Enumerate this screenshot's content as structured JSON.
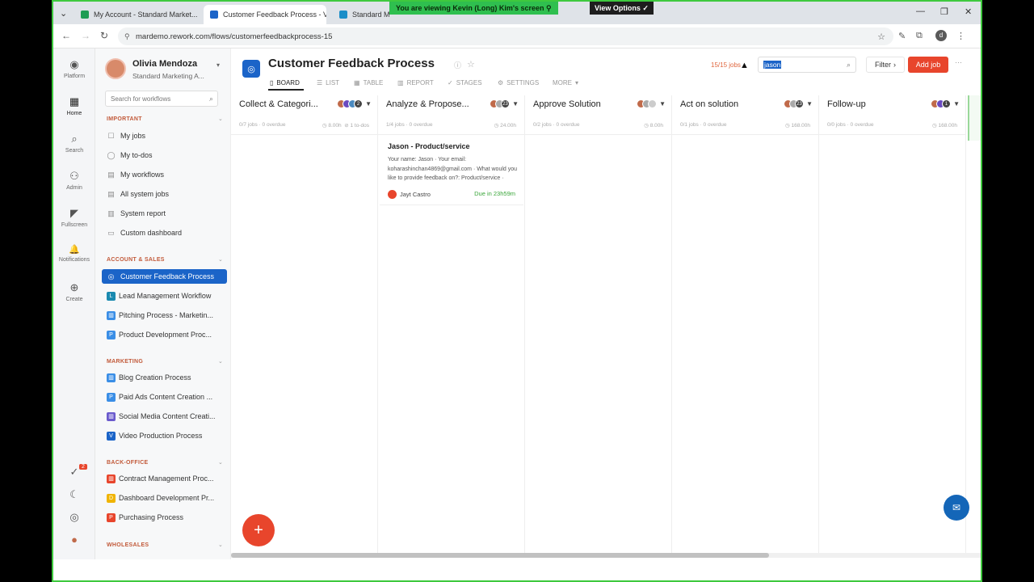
{
  "browser": {
    "tabs": [
      {
        "title": "My Account - Standard Market...",
        "color": "#1f9d55"
      },
      {
        "title": "Customer Feedback Process - V...",
        "color": "#1b64c8"
      },
      {
        "title": "Standard M...",
        "color": "#1b8ec8"
      }
    ],
    "url": "mardemo.rework.com/flows/customerfeedbackprocess-15",
    "share_banner": "You are viewing  Kevin (Long) Kim's screen  ⚲",
    "view_options": "View Options ✓",
    "profile_letter": "d"
  },
  "rail": [
    {
      "label": "Platform",
      "icon": "platform-icon",
      "glyph": "◉"
    },
    {
      "label": "Home",
      "icon": "home-icon",
      "glyph": "▦"
    },
    {
      "label": "Search",
      "icon": "search-icon",
      "glyph": "⌕"
    },
    {
      "label": "Admin",
      "icon": "admin-icon",
      "glyph": "⚇"
    },
    {
      "label": "Fullscreen",
      "icon": "fullscreen-icon",
      "glyph": "◤"
    },
    {
      "label": "Notifications",
      "icon": "bell-icon",
      "glyph": "🔔"
    },
    {
      "label": "Create",
      "icon": "plus-circle-icon",
      "glyph": "⊕"
    }
  ],
  "rail_bottom": {
    "badge": "2"
  },
  "user": {
    "name": "Olivia Mendoza",
    "org": "Standard Marketing A..."
  },
  "sidebar": {
    "search_placeholder": "Search for workflows",
    "important_label": "IMPORTANT",
    "important": [
      {
        "label": "My jobs",
        "icon": "☐"
      },
      {
        "label": "My to-dos",
        "icon": "◯"
      },
      {
        "label": "My workflows",
        "icon": "▤"
      },
      {
        "label": "All system jobs",
        "icon": "▤"
      },
      {
        "label": "System report",
        "icon": "▥"
      },
      {
        "label": "Custom dashboard",
        "icon": "▭"
      }
    ],
    "account_label": "ACCOUNT & SALES",
    "account": [
      {
        "label": "Customer Feedback Process",
        "badge": "◎",
        "color": "#1b64c8"
      },
      {
        "label": "Lead Management Workflow",
        "badge": "L",
        "color": "#1a8ab0"
      },
      {
        "label": "Pitching Process - Marketin...",
        "badge": "▥",
        "color": "#3a8ee6"
      },
      {
        "label": "Product Development Proc...",
        "badge": "P",
        "color": "#3a8ee6"
      }
    ],
    "marketing_label": "MARKETING",
    "marketing": [
      {
        "label": "Blog Creation Process",
        "badge": "▥",
        "color": "#3a8ee6"
      },
      {
        "label": "Paid Ads Content Creation ...",
        "badge": "P",
        "color": "#3a8ee6"
      },
      {
        "label": "Social Media Content Creati...",
        "badge": "▥",
        "color": "#6a5acd"
      },
      {
        "label": "Video Production Process",
        "badge": "V",
        "color": "#1b64c8"
      }
    ],
    "backoffice_label": "BACK-OFFICE",
    "backoffice": [
      {
        "label": "Contract Management Proc...",
        "badge": "▥",
        "color": "#e8452c"
      },
      {
        "label": "Dashboard Development Pr...",
        "badge": "D",
        "color": "#f0b400"
      },
      {
        "label": "Purchasing Process",
        "badge": "P",
        "color": "#e8452c"
      }
    ],
    "wholesales_label": "WHOLESALES"
  },
  "header": {
    "title": "Customer Feedback Process",
    "jobs_count": "15/15 jobs",
    "search_value": "jason",
    "filter_label": "Filter",
    "add_job_label": "Add job",
    "more_dots": "···"
  },
  "view_tabs": [
    {
      "label": "BOARD",
      "glyph": "▯"
    },
    {
      "label": "LIST",
      "glyph": "☰"
    },
    {
      "label": "TABLE",
      "glyph": "▦"
    },
    {
      "label": "REPORT",
      "glyph": "▥"
    },
    {
      "label": "STAGES",
      "glyph": "✓"
    },
    {
      "label": "SETTINGS",
      "glyph": "⚙"
    },
    {
      "label": "MORE",
      "glyph": "▾"
    }
  ],
  "columns": [
    {
      "title": "Collect & Categori...",
      "count_badge": "2",
      "meta": "0/7 jobs · 0 overdue",
      "duration": "8.00h",
      "todos": "1 to-dos",
      "avatar_colors": [
        "#c06a4a",
        "#6a4ac0",
        "#4a8ac0",
        "#333"
      ]
    },
    {
      "title": "Analyze & Propose...",
      "count_badge": "23",
      "meta": "1/4 jobs · 0 overdue",
      "duration": "24.00h",
      "todos": "",
      "avatar_colors": [
        "#c06a4a",
        "#aaaaaa",
        "#999999"
      ]
    },
    {
      "title": "Approve Solution",
      "count_badge": "",
      "meta": "0/2 jobs · 0 overdue",
      "duration": "8.00h",
      "todos": "",
      "avatar_colors": [
        "#c06a4a",
        "#aaaaaa",
        "#cccccc"
      ]
    },
    {
      "title": "Act on solution",
      "count_badge": "23",
      "meta": "0/1 jobs · 0 overdue",
      "duration": "168.00h",
      "todos": "",
      "avatar_colors": [
        "#c06a4a",
        "#aaaaaa"
      ]
    },
    {
      "title": "Follow-up",
      "count_badge": "1",
      "meta": "0/0 jobs · 0 overdue",
      "duration": "168.00h",
      "todos": "",
      "avatar_colors": [
        "#c06a4a",
        "#6a4ac0",
        "#333"
      ]
    }
  ],
  "card": {
    "title": "Jason - Product/service",
    "body": "Your name: Jason · Your email: koharashinchan4869@gmail.com · What would you like to provide feedback on?: Product/service · Please...",
    "assignee": "Jayt Castro",
    "due": "Due in 23h59m"
  }
}
